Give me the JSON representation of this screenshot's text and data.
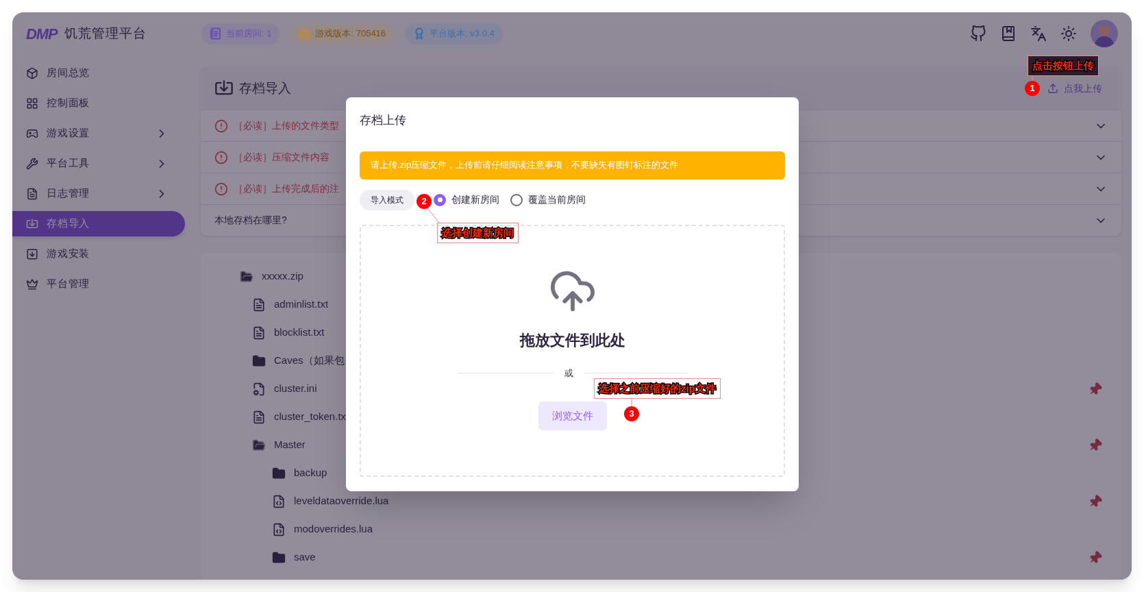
{
  "window": {
    "logo": "DMP",
    "title": "饥荒管理平台"
  },
  "badges": [
    {
      "kind": "room",
      "text": "当前房间: 1",
      "color": "#6a4fb5"
    },
    {
      "kind": "game",
      "text": "游戏版本: 705416",
      "color": "#c28a2a"
    },
    {
      "kind": "platform",
      "text": "平台版本: v3.0.4",
      "color": "#3d6fb0"
    }
  ],
  "sidebar": {
    "items": [
      {
        "kind": "box",
        "label": "房间总览",
        "has_submenu": false,
        "selected": false
      },
      {
        "kind": "grid",
        "label": "控制面板",
        "has_submenu": false,
        "selected": false
      },
      {
        "kind": "gamepad",
        "label": "游戏设置",
        "has_submenu": true,
        "selected": false
      },
      {
        "kind": "wrench",
        "label": "平台工具",
        "has_submenu": true,
        "selected": false
      },
      {
        "kind": "log",
        "label": "日志管理",
        "has_submenu": true,
        "selected": false
      },
      {
        "kind": "import",
        "label": "存档导入",
        "has_submenu": false,
        "selected": true
      },
      {
        "kind": "install",
        "label": "游戏安装",
        "has_submenu": false,
        "selected": false
      },
      {
        "kind": "crown",
        "label": "平台管理",
        "has_submenu": false,
        "selected": false
      }
    ]
  },
  "card": {
    "title": "存档导入",
    "upload_link": "点我上传",
    "sections": [
      {
        "kind": "warning",
        "label": "［必读］上传的文件类型",
        "expanded": false
      },
      {
        "kind": "warning",
        "label": "［必读］压缩文件内容",
        "expanded": false
      },
      {
        "kind": "warning",
        "label": "［必读］上传完成后的注",
        "expanded": false
      },
      {
        "kind": "plain",
        "label": "本地存档在哪里?",
        "expanded": false
      }
    ]
  },
  "tree": {
    "name": "xxxxx.zip",
    "kind": "folder-open",
    "pinned": false,
    "children": [
      {
        "name": "adminlist.txt",
        "kind": "text",
        "pinned": false
      },
      {
        "name": "blocklist.txt",
        "kind": "text",
        "pinned": false
      },
      {
        "name": "Caves（如果包",
        "kind": "folder",
        "pinned": false
      },
      {
        "name": "cluster.ini",
        "kind": "config",
        "pinned": true
      },
      {
        "name": "cluster_token.tx",
        "kind": "text",
        "pinned": false
      },
      {
        "name": "Master",
        "kind": "folder-open",
        "pinned": true,
        "children": [
          {
            "name": "backup",
            "kind": "folder",
            "pinned": false
          },
          {
            "name": "leveldataoverride.lua",
            "kind": "code",
            "pinned": true
          },
          {
            "name": "modoverrides.lua",
            "kind": "code",
            "pinned": false
          },
          {
            "name": "save",
            "kind": "folder",
            "pinned": true
          }
        ]
      }
    ]
  },
  "modal": {
    "title": "存档上传",
    "alert": "请上传.zip压缩文件，上传前请仔细阅读注意事项，不要缺失有图钉标注的文件",
    "mode_label": "导入模式",
    "modes": [
      {
        "label": "创建新房间",
        "selected": true
      },
      {
        "label": "覆盖当前房间",
        "selected": false
      }
    ],
    "drop_title": "拖放文件到此处",
    "divider": "或",
    "browse_button": "浏览文件"
  },
  "annotations": [
    {
      "number": "1",
      "label": "点击按钮上传"
    },
    {
      "number": "2",
      "label": "选择创建新房间"
    },
    {
      "number": "3",
      "label": "选择之前压缩好的zip文件"
    }
  ]
}
